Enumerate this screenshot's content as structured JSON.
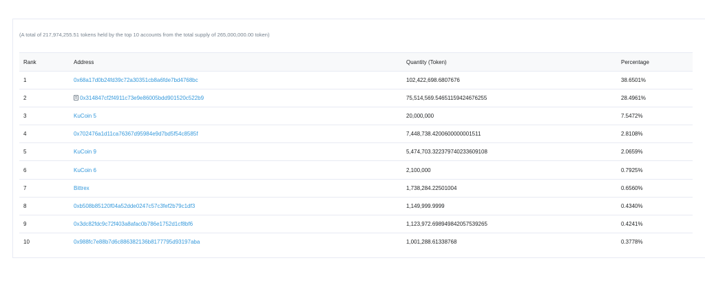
{
  "summary_text": "(A total of 217,974,255.51 tokens held by the top 10 accounts from the total supply of 265,000,000.00 token)",
  "table": {
    "headers": {
      "rank": "Rank",
      "address": "Address",
      "quantity": "Quantity (Token)",
      "percentage": "Percentage"
    },
    "rows": [
      {
        "rank": "1",
        "address": "0x68a17d0b24fd39c72a30351cb8a6fde7bd4768bc",
        "quantity": "102,422,698.6807676",
        "percentage": "38.6501%",
        "is_contract": false
      },
      {
        "rank": "2",
        "address": "0x314847cf2f4911c73e9e86005bdd901520c522b9",
        "quantity": "75,514,569.54651159424676255",
        "percentage": "28.4961%",
        "is_contract": true,
        "icon": "contract-icon"
      },
      {
        "rank": "3",
        "address": "KuCoin 5",
        "quantity": "20,000,000",
        "percentage": "7.5472%",
        "is_contract": false
      },
      {
        "rank": "4",
        "address": "0x702476a1d11ca76367d95984e9d7bd5f54c8585f",
        "quantity": "7,448,738.4200600000001511",
        "percentage": "2.8108%",
        "is_contract": false
      },
      {
        "rank": "5",
        "address": "KuCoin 9",
        "quantity": "5,474,703.322379740233609108",
        "percentage": "2.0659%",
        "is_contract": false
      },
      {
        "rank": "6",
        "address": "KuCoin 6",
        "quantity": "2,100,000",
        "percentage": "0.7925%",
        "is_contract": false
      },
      {
        "rank": "7",
        "address": "Bittrex",
        "quantity": "1,738,284.22501004",
        "percentage": "0.6560%",
        "is_contract": false
      },
      {
        "rank": "8",
        "address": "0xb508b85120f04a52dde0247c57c3fef2b79c1df3",
        "quantity": "1,149,999.9999",
        "percentage": "0.4340%",
        "is_contract": false
      },
      {
        "rank": "9",
        "address": "0x3dc82fdc9c72f403a8afac0b786e1752d1cf8bf6",
        "quantity": "1,123,972.698949842057539265",
        "percentage": "0.4241%",
        "is_contract": false
      },
      {
        "rank": "10",
        "address": "0x988fc7e88b7d6c886382136b8177795d93197aba",
        "quantity": "1,001,288.61338768",
        "percentage": "0.3778%",
        "is_contract": false
      }
    ]
  },
  "colors": {
    "link": "#3498db",
    "muted_text": "#77838f",
    "border": "#e7eaf3",
    "header_bg": "#f8f9fa"
  }
}
